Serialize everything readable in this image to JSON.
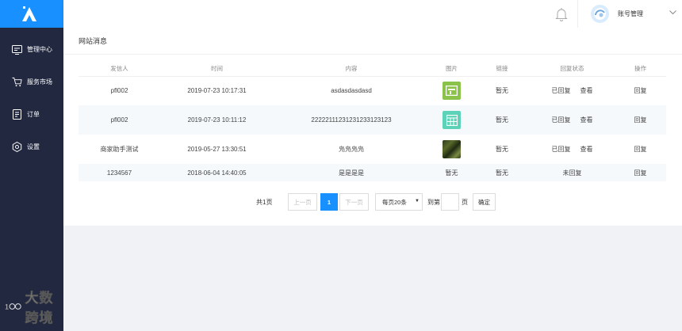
{
  "sidebar": {
    "items": [
      {
        "label": "管理中心",
        "icon": "monitor-icon"
      },
      {
        "label": "服务市场",
        "icon": "cart-icon"
      },
      {
        "label": "订单",
        "icon": "document-icon"
      },
      {
        "label": "设置",
        "icon": "gear-icon"
      }
    ],
    "watermark": "大数跨境"
  },
  "header": {
    "account_label": "账号管理"
  },
  "page": {
    "title": "网站消息"
  },
  "table": {
    "columns": [
      "发信人",
      "时间",
      "内容",
      "图片",
      "链接",
      "回复状态",
      "操作"
    ],
    "rows": [
      {
        "sender": "pfl002",
        "time": "2019-07-23 10:17:31",
        "content": "asdasdasdasd",
        "image": "green-thumbnail",
        "link": "暂无",
        "status": "已回复",
        "view": "查看",
        "action": "回复"
      },
      {
        "sender": "pfl002",
        "time": "2019-07-23 10:11:12",
        "content": "22222111231231233123123",
        "image": "teal-thumbnail",
        "link": "暂无",
        "status": "已回复",
        "view": "查看",
        "action": "回复"
      },
      {
        "sender": "商家助手测试",
        "time": "2019-05-27 13:30:51",
        "content": "凫凫凫凫",
        "image": "photo-thumbnail",
        "link": "暂无",
        "status": "已回复",
        "view": "查看",
        "action": "回复"
      },
      {
        "sender": "1234567",
        "time": "2018-06-04 14:40:05",
        "content": "是是是是",
        "image_text": "暂无",
        "link": "暂无",
        "status": "未回复",
        "action": "回复"
      }
    ]
  },
  "pagination": {
    "total": "共1页",
    "prev": "上一页",
    "current": "1",
    "next": "下一页",
    "page_size": "每页20条",
    "goto_label": "到第",
    "page_suffix": "页",
    "confirm": "确定"
  },
  "colors": {
    "accent": "#1890ff",
    "sidebar_bg": "#222840"
  }
}
